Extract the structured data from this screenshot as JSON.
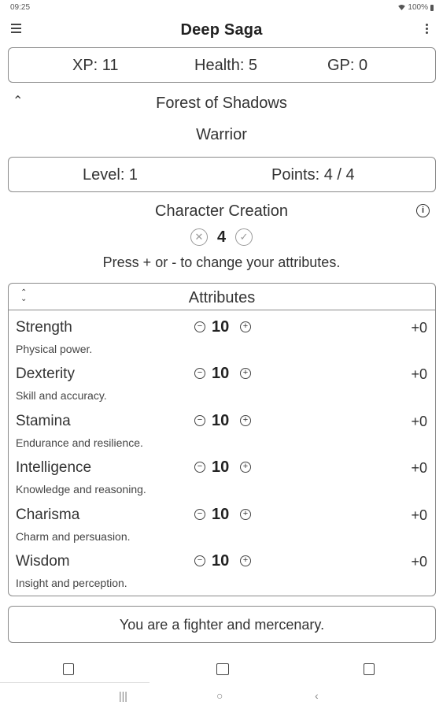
{
  "status": {
    "time": "09:25",
    "battery": "100%"
  },
  "app": {
    "title": "Deep Saga"
  },
  "stats": {
    "xp": "XP: 11",
    "health": "Health:  5",
    "gp": "GP:  0"
  },
  "location": "Forest of Shadows",
  "character_class": "Warrior",
  "level": {
    "level": "Level: 1",
    "points": "Points: 4 / 4"
  },
  "creation": {
    "title": "Character Creation",
    "count": "4",
    "hint": "Press + or - to change your attributes."
  },
  "attributes": {
    "title": "Attributes",
    "items": [
      {
        "name": "Strength",
        "desc": "Physical power.",
        "value": "10",
        "mod": "+0"
      },
      {
        "name": "Dexterity",
        "desc": "Skill and accuracy.",
        "value": "10",
        "mod": "+0"
      },
      {
        "name": "Stamina",
        "desc": "Endurance and resilience.",
        "value": "10",
        "mod": "+0"
      },
      {
        "name": "Intelligence",
        "desc": "Knowledge and reasoning.",
        "value": "10",
        "mod": "+0"
      },
      {
        "name": "Charisma",
        "desc": "Charm and persuasion.",
        "value": "10",
        "mod": "+0"
      },
      {
        "name": "Wisdom",
        "desc": "Insight and perception.",
        "value": "10",
        "mod": "+0"
      }
    ]
  },
  "description": "You are a fighter and mercenary.",
  "icons": {
    "menu": "hamburger-menu-icon",
    "overflow": "more-vert-icon",
    "info": "info-icon",
    "cancel": "cancel-circle-icon",
    "confirm": "check-circle-icon",
    "nav": [
      "character-icon",
      "map-book-icon",
      "journal-icon"
    ]
  }
}
